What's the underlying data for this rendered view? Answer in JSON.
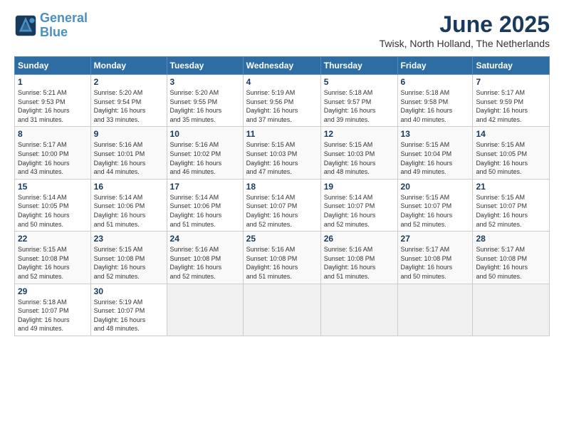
{
  "header": {
    "logo_line1": "General",
    "logo_line2": "Blue",
    "month_title": "June 2025",
    "location": "Twisk, North Holland, The Netherlands"
  },
  "weekdays": [
    "Sunday",
    "Monday",
    "Tuesday",
    "Wednesday",
    "Thursday",
    "Friday",
    "Saturday"
  ],
  "weeks": [
    [
      {
        "day": "1",
        "info": "Sunrise: 5:21 AM\nSunset: 9:53 PM\nDaylight: 16 hours\nand 31 minutes."
      },
      {
        "day": "2",
        "info": "Sunrise: 5:20 AM\nSunset: 9:54 PM\nDaylight: 16 hours\nand 33 minutes."
      },
      {
        "day": "3",
        "info": "Sunrise: 5:20 AM\nSunset: 9:55 PM\nDaylight: 16 hours\nand 35 minutes."
      },
      {
        "day": "4",
        "info": "Sunrise: 5:19 AM\nSunset: 9:56 PM\nDaylight: 16 hours\nand 37 minutes."
      },
      {
        "day": "5",
        "info": "Sunrise: 5:18 AM\nSunset: 9:57 PM\nDaylight: 16 hours\nand 39 minutes."
      },
      {
        "day": "6",
        "info": "Sunrise: 5:18 AM\nSunset: 9:58 PM\nDaylight: 16 hours\nand 40 minutes."
      },
      {
        "day": "7",
        "info": "Sunrise: 5:17 AM\nSunset: 9:59 PM\nDaylight: 16 hours\nand 42 minutes."
      }
    ],
    [
      {
        "day": "8",
        "info": "Sunrise: 5:17 AM\nSunset: 10:00 PM\nDaylight: 16 hours\nand 43 minutes."
      },
      {
        "day": "9",
        "info": "Sunrise: 5:16 AM\nSunset: 10:01 PM\nDaylight: 16 hours\nand 44 minutes."
      },
      {
        "day": "10",
        "info": "Sunrise: 5:16 AM\nSunset: 10:02 PM\nDaylight: 16 hours\nand 46 minutes."
      },
      {
        "day": "11",
        "info": "Sunrise: 5:15 AM\nSunset: 10:03 PM\nDaylight: 16 hours\nand 47 minutes."
      },
      {
        "day": "12",
        "info": "Sunrise: 5:15 AM\nSunset: 10:03 PM\nDaylight: 16 hours\nand 48 minutes."
      },
      {
        "day": "13",
        "info": "Sunrise: 5:15 AM\nSunset: 10:04 PM\nDaylight: 16 hours\nand 49 minutes."
      },
      {
        "day": "14",
        "info": "Sunrise: 5:15 AM\nSunset: 10:05 PM\nDaylight: 16 hours\nand 50 minutes."
      }
    ],
    [
      {
        "day": "15",
        "info": "Sunrise: 5:14 AM\nSunset: 10:05 PM\nDaylight: 16 hours\nand 50 minutes."
      },
      {
        "day": "16",
        "info": "Sunrise: 5:14 AM\nSunset: 10:06 PM\nDaylight: 16 hours\nand 51 minutes."
      },
      {
        "day": "17",
        "info": "Sunrise: 5:14 AM\nSunset: 10:06 PM\nDaylight: 16 hours\nand 51 minutes."
      },
      {
        "day": "18",
        "info": "Sunrise: 5:14 AM\nSunset: 10:07 PM\nDaylight: 16 hours\nand 52 minutes."
      },
      {
        "day": "19",
        "info": "Sunrise: 5:14 AM\nSunset: 10:07 PM\nDaylight: 16 hours\nand 52 minutes."
      },
      {
        "day": "20",
        "info": "Sunrise: 5:15 AM\nSunset: 10:07 PM\nDaylight: 16 hours\nand 52 minutes."
      },
      {
        "day": "21",
        "info": "Sunrise: 5:15 AM\nSunset: 10:07 PM\nDaylight: 16 hours\nand 52 minutes."
      }
    ],
    [
      {
        "day": "22",
        "info": "Sunrise: 5:15 AM\nSunset: 10:08 PM\nDaylight: 16 hours\nand 52 minutes."
      },
      {
        "day": "23",
        "info": "Sunrise: 5:15 AM\nSunset: 10:08 PM\nDaylight: 16 hours\nand 52 minutes."
      },
      {
        "day": "24",
        "info": "Sunrise: 5:16 AM\nSunset: 10:08 PM\nDaylight: 16 hours\nand 52 minutes."
      },
      {
        "day": "25",
        "info": "Sunrise: 5:16 AM\nSunset: 10:08 PM\nDaylight: 16 hours\nand 51 minutes."
      },
      {
        "day": "26",
        "info": "Sunrise: 5:16 AM\nSunset: 10:08 PM\nDaylight: 16 hours\nand 51 minutes."
      },
      {
        "day": "27",
        "info": "Sunrise: 5:17 AM\nSunset: 10:08 PM\nDaylight: 16 hours\nand 50 minutes."
      },
      {
        "day": "28",
        "info": "Sunrise: 5:17 AM\nSunset: 10:08 PM\nDaylight: 16 hours\nand 50 minutes."
      }
    ],
    [
      {
        "day": "29",
        "info": "Sunrise: 5:18 AM\nSunset: 10:07 PM\nDaylight: 16 hours\nand 49 minutes."
      },
      {
        "day": "30",
        "info": "Sunrise: 5:19 AM\nSunset: 10:07 PM\nDaylight: 16 hours\nand 48 minutes."
      },
      {
        "day": "",
        "info": ""
      },
      {
        "day": "",
        "info": ""
      },
      {
        "day": "",
        "info": ""
      },
      {
        "day": "",
        "info": ""
      },
      {
        "day": "",
        "info": ""
      }
    ]
  ]
}
